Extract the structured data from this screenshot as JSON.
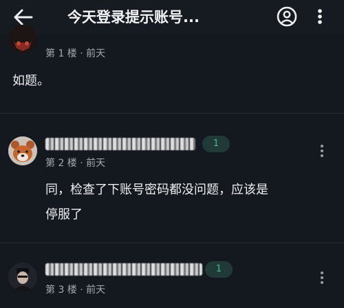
{
  "header": {
    "title": "今天登录提示账号...",
    "icons": [
      "back-arrow-icon",
      "account-circle-icon",
      "more-vert-icon"
    ]
  },
  "posts": [
    {
      "floor": "第 1 楼 · 前天",
      "content": "如题。"
    },
    {
      "badge": "1",
      "floor": "第 2 楼 · 前天",
      "content_line1": "同，检查了下账号密码都没问题，应该是",
      "content_line2": "停服了"
    },
    {
      "badge": "1",
      "floor": "第 3 楼 · 前天"
    }
  ],
  "colors": {
    "background": "#14181f",
    "badge_bg": "#1f3a37",
    "badge_text": "#4fb59d"
  }
}
